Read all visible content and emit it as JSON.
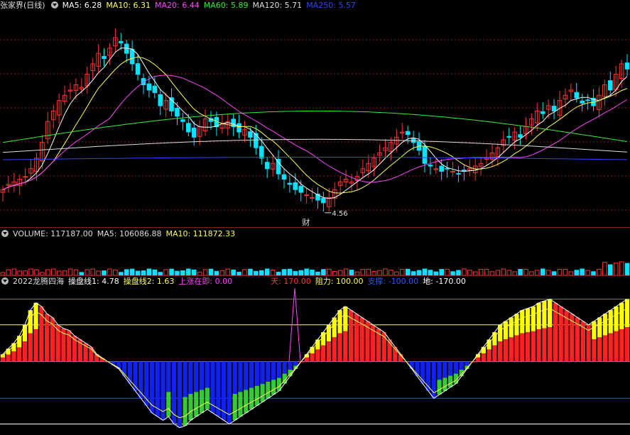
{
  "main": {
    "title": "张家界(日线)",
    "ma": [
      {
        "label": "MA5: 6.28",
        "color": "#ffffff"
      },
      {
        "label": "MA10: 6.31",
        "color": "#ffff55"
      },
      {
        "label": "MA20: 6.44",
        "color": "#ff44ff"
      },
      {
        "label": "MA60: 5.89",
        "color": "#33ee33"
      },
      {
        "label": "MA120: 5.71",
        "color": "#dddddd"
      },
      {
        "label": "MA250: 5.57",
        "color": "#3344ff"
      }
    ],
    "low_annotation": "4.56",
    "event_marker": "财"
  },
  "volume": {
    "label": "VOLUME: 117187.00",
    "ma5": "MA5: 106086.88",
    "ma10": "MA10: 111872.33"
  },
  "indicator": {
    "name": "2022龙腾四海",
    "items": [
      {
        "label": "操盘线1: 4.78",
        "color": "#ffffff"
      },
      {
        "label": "操盘线2: 1.63",
        "color": "#ffff55"
      },
      {
        "label": "上涨在即: 0.00",
        "color": "#ff44ff"
      },
      {
        "label": "天: 170.00",
        "color": "#ff3333"
      },
      {
        "label": "阻力: 100.00",
        "color": "#ffff55"
      },
      {
        "label": "支撑: -100.00",
        "color": "#3355ff"
      },
      {
        "label": "地: -170.00",
        "color": "#ffffff"
      }
    ]
  },
  "colors": {
    "up": "#ff3333",
    "down": "#00e5ff",
    "grid": "#8b1a1a"
  },
  "chart_data": [
    {
      "type": "candlestick",
      "title": "张家界(日线)",
      "low_marked": 4.56,
      "series_ma": {
        "MA5": 6.28,
        "MA10": 6.31,
        "MA20": 6.44,
        "MA60": 5.89,
        "MA120": 5.71,
        "MA250": 5.57
      },
      "closes": [
        5.0,
        5.1,
        5.15,
        5.2,
        5.25,
        5.4,
        5.6,
        5.9,
        6.3,
        6.5,
        6.7,
        6.8,
        6.9,
        7.0,
        6.95,
        7.2,
        7.4,
        7.6,
        7.5,
        7.7,
        7.9,
        7.8,
        7.6,
        7.4,
        7.2,
        7.0,
        6.9,
        6.85,
        6.6,
        6.7,
        6.5,
        6.4,
        6.3,
        6.1,
        6.0,
        6.2,
        6.35,
        6.3,
        6.2,
        6.25,
        6.3,
        6.2,
        6.1,
        6.15,
        6.0,
        5.8,
        5.6,
        5.4,
        5.5,
        5.3,
        5.2,
        5.1,
        5.0,
        4.95,
        4.9,
        4.85,
        4.8,
        4.75,
        4.85,
        5.0,
        5.15,
        5.2,
        5.15,
        5.25,
        5.4,
        5.5,
        5.6,
        5.7,
        5.8,
        5.9,
        6.0,
        6.1,
        6.05,
        5.9,
        5.75,
        5.5,
        5.45,
        5.4,
        5.35,
        5.4,
        5.35,
        5.3,
        5.35,
        5.4,
        5.45,
        5.5,
        5.6,
        5.7,
        5.8,
        5.95,
        6.0,
        6.1,
        6.0,
        6.2,
        6.35,
        6.5,
        6.45,
        6.6,
        6.5,
        6.7,
        6.8,
        6.9,
        6.75,
        6.65,
        6.7,
        6.6,
        6.8,
        7.0,
        6.9,
        7.2,
        7.4,
        7.3
      ]
    },
    {
      "type": "bar",
      "title": "VOLUME",
      "values": [
        117187.0
      ],
      "series": [
        {
          "name": "MA5",
          "values": [
            106086.88
          ]
        },
        {
          "name": "MA10",
          "values": [
            111872.33
          ]
        }
      ]
    },
    {
      "type": "bar",
      "title": "2022龙腾四海",
      "levels": {
        "天": 170,
        "阻力": 100,
        "支撑": -100,
        "地": -170
      },
      "series": [
        {
          "name": "操盘线1",
          "values": [
            4.78
          ]
        },
        {
          "name": "操盘线2",
          "values": [
            1.63
          ]
        },
        {
          "name": "上涨在即",
          "values": [
            0.0
          ]
        }
      ],
      "osc": [
        20,
        35,
        50,
        70,
        100,
        140,
        160,
        150,
        130,
        120,
        100,
        90,
        85,
        70,
        60,
        50,
        40,
        20,
        10,
        0,
        -10,
        -20,
        -40,
        -60,
        -80,
        -100,
        -120,
        -140,
        -150,
        -160,
        -150,
        -170,
        -180,
        -175,
        -160,
        -150,
        -140,
        -130,
        -140,
        -150,
        -160,
        -170,
        -160,
        -150,
        -140,
        -130,
        -120,
        -110,
        -100,
        -90,
        -80,
        -60,
        -40,
        -20,
        0,
        20,
        40,
        60,
        80,
        100,
        120,
        140,
        150,
        140,
        130,
        120,
        110,
        100,
        90,
        80,
        60,
        40,
        20,
        0,
        -20,
        -40,
        -60,
        -80,
        -100,
        -90,
        -80,
        -70,
        -60,
        -40,
        -20,
        0,
        20,
        40,
        60,
        80,
        100,
        110,
        120,
        130,
        140,
        145,
        150,
        160,
        165,
        170,
        160,
        150,
        140,
        130,
        120,
        110,
        100,
        110,
        120,
        130,
        140,
        150,
        160,
        170
      ]
    }
  ]
}
